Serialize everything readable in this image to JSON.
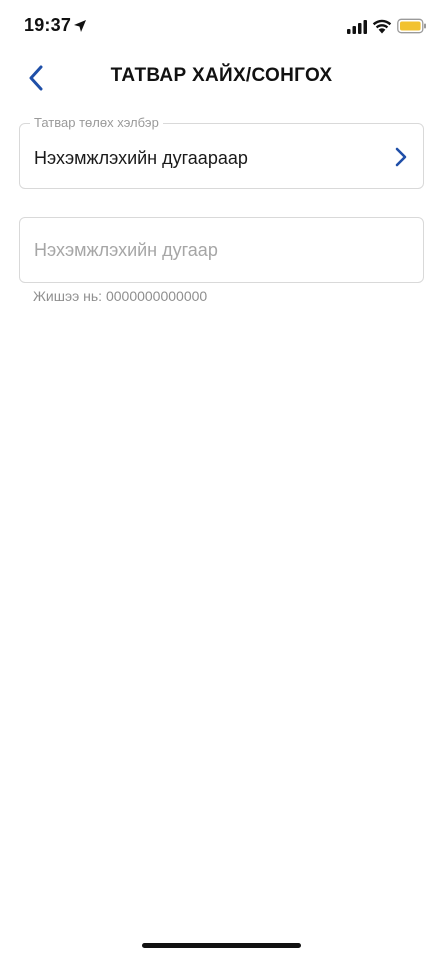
{
  "status_bar": {
    "time": "19:37",
    "icons": [
      "location-arrow-icon",
      "cellular-signal-icon",
      "wifi-icon",
      "battery-icon"
    ],
    "battery_color": "#f2c230"
  },
  "header": {
    "title": "ТАТВАР ХАЙХ/СОНГОХ",
    "accent_color": "#1f4fa8"
  },
  "form": {
    "payment_type": {
      "label": "Татвар төлөх хэлбэр",
      "value": "Нэхэмжлэхийн дугаараар"
    },
    "invoice_number": {
      "value": "",
      "placeholder": "Нэхэмжлэхийн дугаар",
      "helper": "Жишээ нь: 0000000000000"
    }
  }
}
